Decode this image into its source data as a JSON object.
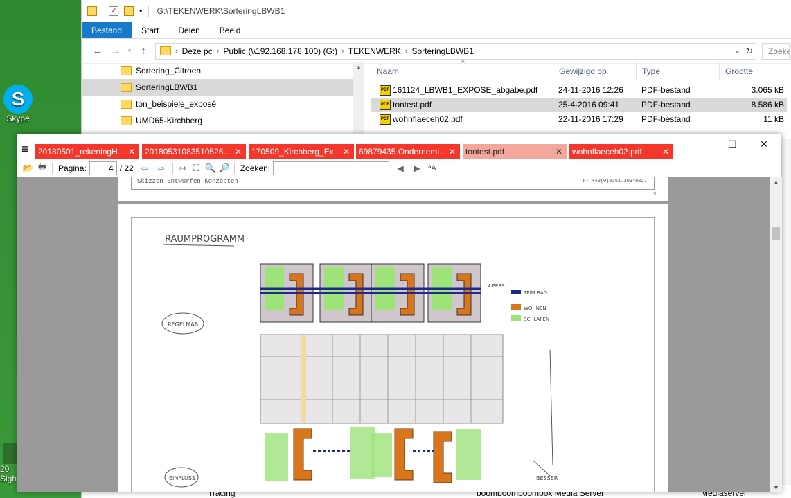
{
  "desktop": {
    "skype_label": "Skype",
    "sight_label": "20\nSigh"
  },
  "explorer": {
    "path_title": "G:\\TEKENWERK\\SorteringLBWB1",
    "ribbon": [
      "Bestand",
      "Start",
      "Delen",
      "Beeld"
    ],
    "breadcrumbs": [
      "Deze pc",
      "Public (\\\\192.168.178.100) (G:)",
      "TEKENWERK",
      "SorteringLBWB1"
    ],
    "search_placeholder": "Zoeke",
    "nav_items": [
      {
        "label": "Sortering_Citroen"
      },
      {
        "label": "SorteringLBWB1"
      },
      {
        "label": "ton_beispiele_exposé"
      },
      {
        "label": "UMD65-Kirchberg"
      }
    ],
    "columns": {
      "name": "Naam",
      "modified": "Gewijzigd op",
      "type": "Type",
      "size": "Grootte"
    },
    "files": [
      {
        "name": "161124_LBWB1_EXPOSE_abgabe.pdf",
        "modified": "24-11-2016 12:26",
        "type": "PDF-bestand",
        "size": "3.065 kB"
      },
      {
        "name": "tontest.pdf",
        "modified": "25-4-2016 09:41",
        "type": "PDF-bestand",
        "size": "8.586 kB"
      },
      {
        "name": "wohnflaeceh02.pdf",
        "modified": "22-11-2016 17:29",
        "type": "PDF-bestand",
        "size": "11 kB"
      }
    ],
    "lower_items": {
      "tracing": "Tracing",
      "media_server": "boomboomboombox Media Server",
      "media_type": "Mediaserver"
    },
    "pdf_badge": "PDF"
  },
  "pdfviewer": {
    "tabs": [
      {
        "label": "20180501_rekeningH..."
      },
      {
        "label": "20180531083510526..."
      },
      {
        "label": "170509_Kirchberg_Ex..."
      },
      {
        "label": "69879435 Ondernemi..."
      },
      {
        "label": "tontest.pdf"
      },
      {
        "label": "wohnflaeceh02.pdf"
      }
    ],
    "toolbar": {
      "page_label": "Pagina:",
      "page_current": "4",
      "page_total": "/ 22",
      "find_label": "Zoeken:",
      "find_placeholder": ""
    },
    "prev_page": {
      "footer_left": "Skizzen Entwürfen Konzepten",
      "footer_right": "F: +49(0)0351.30940027",
      "page_number": "3"
    },
    "drawing": {
      "title": "RAUMPROGRAMM",
      "left_label_1": "REGELMAB",
      "left_label_2": "EINFLUSS",
      "legend_1": "TEIM BAD",
      "legend_2": "WOHNEN",
      "legend_3": "SCHLAFEN",
      "side_note": "4 PERS",
      "bottom_note": "BESSER"
    }
  },
  "colors": {
    "tab_red": "#f4372a",
    "tab_active": "#f4a79d",
    "ribbon_blue": "#1979ca"
  }
}
